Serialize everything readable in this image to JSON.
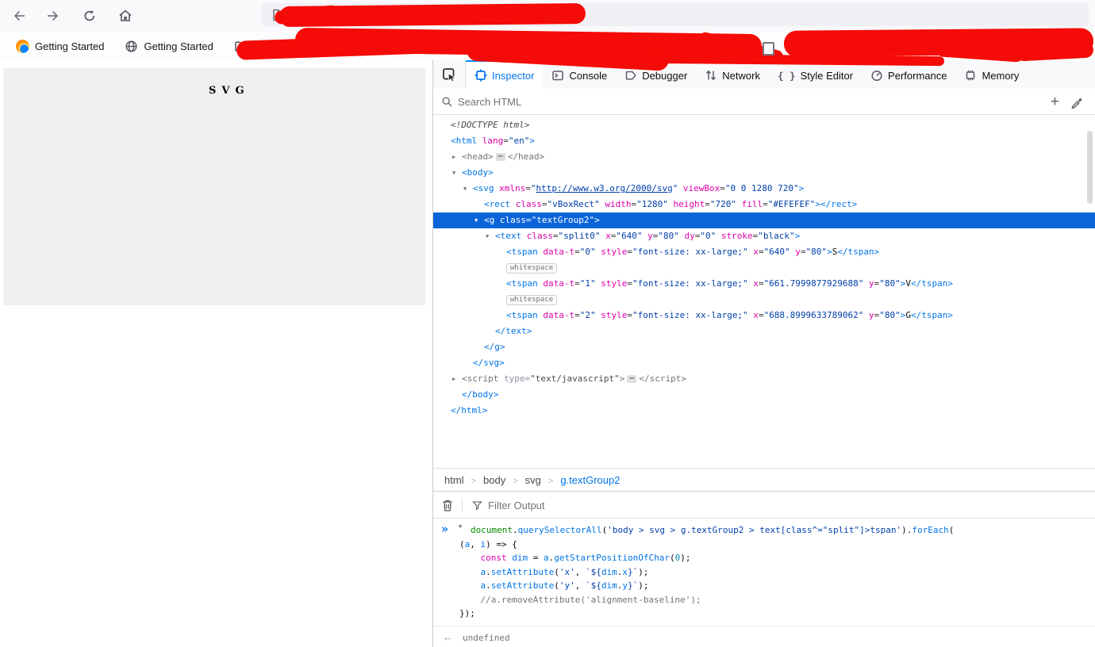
{
  "browser": {
    "nav": {
      "back_icon": "back-arrow",
      "forward_icon": "forward-arrow",
      "reload_icon": "reload",
      "home_icon": "home",
      "url_bar": {
        "value": "",
        "page_icon": "file"
      }
    },
    "bookmarks": [
      {
        "icon": "firefox-logo",
        "label": "Getting Started"
      },
      {
        "icon": "globe",
        "label": "Getting Started"
      },
      {
        "icon": "folder",
        "label": ""
      }
    ]
  },
  "page": {
    "svg_letters": [
      "S",
      "V",
      "G"
    ],
    "rect_fill": "#EFEFEF"
  },
  "devtools": {
    "tabs": [
      {
        "id": "inspector",
        "label": "Inspector",
        "active": true
      },
      {
        "id": "console",
        "label": "Console",
        "active": false
      },
      {
        "id": "debugger",
        "label": "Debugger",
        "active": false
      },
      {
        "id": "network",
        "label": "Network",
        "active": false
      },
      {
        "id": "style-editor",
        "label": "Style Editor",
        "active": false
      },
      {
        "id": "performance",
        "label": "Performance",
        "active": false
      },
      {
        "id": "memory",
        "label": "Memory",
        "active": false
      }
    ],
    "search": {
      "placeholder": "Search HTML"
    },
    "markup": {
      "rows": [
        {
          "i": 0,
          "tk": [
            [
              "d",
              "<!DOCTYPE html>"
            ]
          ]
        },
        {
          "i": 0,
          "tk": [
            [
              "t",
              "<html"
            ],
            [
              "a",
              " lang"
            ],
            [
              "p",
              "="
            ],
            [
              "v",
              "\"en\""
            ],
            [
              "t",
              ">"
            ]
          ]
        },
        {
          "i": 1,
          "ar": "r",
          "tk": [
            [
              "mt",
              "<head>"
            ],
            [
              "be",
              "⋯"
            ],
            [
              "mt",
              "</head>"
            ]
          ]
        },
        {
          "i": 1,
          "ar": "d",
          "tk": [
            [
              "t",
              "<body>"
            ]
          ]
        },
        {
          "i": 2,
          "ar": "d",
          "tk": [
            [
              "t",
              "<svg"
            ],
            [
              "a",
              " xmlns"
            ],
            [
              "p",
              "="
            ],
            [
              "v",
              "\""
            ],
            [
              "u",
              "http://www.w3.org/2000/svg"
            ],
            [
              "v",
              "\""
            ],
            [
              "a",
              " viewBox"
            ],
            [
              "p",
              "="
            ],
            [
              "v",
              "\"0 0 1280 720\""
            ],
            [
              "t",
              ">"
            ]
          ]
        },
        {
          "i": 3,
          "tk": [
            [
              "t",
              "<rect"
            ],
            [
              "a",
              " class"
            ],
            [
              "p",
              "="
            ],
            [
              "v",
              "\"vBoxRect\""
            ],
            [
              "a",
              " width"
            ],
            [
              "p",
              "="
            ],
            [
              "v",
              "\"1280\""
            ],
            [
              "a",
              " height"
            ],
            [
              "p",
              "="
            ],
            [
              "v",
              "\"720\""
            ],
            [
              "a",
              " fill"
            ],
            [
              "p",
              "="
            ],
            [
              "v",
              "\"#EFEFEF\""
            ],
            [
              "t",
              "></rect>"
            ]
          ]
        },
        {
          "i": 3,
          "ar": "d",
          "sel": true,
          "tk": [
            [
              "t",
              "<g"
            ],
            [
              "a",
              " class"
            ],
            [
              "p",
              "="
            ],
            [
              "v",
              "\"textGroup2\""
            ],
            [
              "t",
              ">"
            ]
          ]
        },
        {
          "i": 4,
          "ar": "d",
          "tk": [
            [
              "t",
              "<text"
            ],
            [
              "a",
              " class"
            ],
            [
              "p",
              "="
            ],
            [
              "v",
              "\"split0\""
            ],
            [
              "a",
              " x"
            ],
            [
              "p",
              "="
            ],
            [
              "v",
              "\"640\""
            ],
            [
              "a",
              " y"
            ],
            [
              "p",
              "="
            ],
            [
              "v",
              "\"80\""
            ],
            [
              "a",
              " dy"
            ],
            [
              "p",
              "="
            ],
            [
              "v",
              "\"0\""
            ],
            [
              "a",
              " stroke"
            ],
            [
              "p",
              "="
            ],
            [
              "v",
              "\"black\""
            ],
            [
              "t",
              ">"
            ]
          ]
        },
        {
          "i": 5,
          "tk": [
            [
              "t",
              "<tspan"
            ],
            [
              "a",
              " data-t"
            ],
            [
              "p",
              "="
            ],
            [
              "v",
              "\"0\""
            ],
            [
              "a",
              " style"
            ],
            [
              "p",
              "="
            ],
            [
              "v",
              "\"font-size: xx-large;\""
            ],
            [
              "a",
              " x"
            ],
            [
              "p",
              "="
            ],
            [
              "v",
              "\"640\""
            ],
            [
              "a",
              " y"
            ],
            [
              "p",
              "="
            ],
            [
              "v",
              "\"80\""
            ],
            [
              "t",
              ">"
            ],
            [
              "x",
              "S"
            ],
            [
              "t",
              "</tspan>"
            ]
          ]
        },
        {
          "i": 5,
          "tk": [
            [
              "bw",
              "whitespace"
            ]
          ]
        },
        {
          "i": 5,
          "tk": [
            [
              "t",
              "<tspan"
            ],
            [
              "a",
              " data-t"
            ],
            [
              "p",
              "="
            ],
            [
              "v",
              "\"1\""
            ],
            [
              "a",
              " style"
            ],
            [
              "p",
              "="
            ],
            [
              "v",
              "\"font-size: xx-large;\""
            ],
            [
              "a",
              " x"
            ],
            [
              "p",
              "="
            ],
            [
              "v",
              "\"661.7999877929688\""
            ],
            [
              "a",
              " y"
            ],
            [
              "p",
              "="
            ],
            [
              "v",
              "\"80\""
            ],
            [
              "t",
              ">"
            ],
            [
              "x",
              "V"
            ],
            [
              "t",
              "</tspan>"
            ]
          ]
        },
        {
          "i": 5,
          "tk": [
            [
              "bw",
              "whitespace"
            ]
          ]
        },
        {
          "i": 5,
          "tk": [
            [
              "t",
              "<tspan"
            ],
            [
              "a",
              " data-t"
            ],
            [
              "p",
              "="
            ],
            [
              "v",
              "\"2\""
            ],
            [
              "a",
              " style"
            ],
            [
              "p",
              "="
            ],
            [
              "v",
              "\"font-size: xx-large;\""
            ],
            [
              "a",
              " x"
            ],
            [
              "p",
              "="
            ],
            [
              "v",
              "\"688.8999633789062\""
            ],
            [
              "a",
              " y"
            ],
            [
              "p",
              "="
            ],
            [
              "v",
              "\"80\""
            ],
            [
              "t",
              ">"
            ],
            [
              "x",
              "G"
            ],
            [
              "t",
              "</tspan>"
            ]
          ]
        },
        {
          "i": 4,
          "tk": [
            [
              "t",
              "</text>"
            ]
          ]
        },
        {
          "i": 3,
          "tk": [
            [
              "t",
              "</g>"
            ]
          ]
        },
        {
          "i": 2,
          "tk": [
            [
              "t",
              "</svg>"
            ]
          ]
        },
        {
          "i": 1,
          "ar": "r",
          "tk": [
            [
              "mt",
              "<script"
            ],
            [
              "ma",
              " type"
            ],
            [
              "mp",
              "="
            ],
            [
              "mv",
              "\"text/javascript\""
            ],
            [
              "mt",
              ">"
            ],
            [
              "be",
              "⋯"
            ],
            [
              "mt",
              "</script>"
            ]
          ]
        },
        {
          "i": 1,
          "tk": [
            [
              "t",
              "</body>"
            ]
          ]
        },
        {
          "i": 0,
          "tk": [
            [
              "t",
              "</html>"
            ]
          ]
        }
      ]
    },
    "breadcrumbs": [
      {
        "label": "html",
        "selected": false
      },
      {
        "label": "body",
        "selected": false
      },
      {
        "label": "svg",
        "selected": false
      },
      {
        "label": "g.textGroup2",
        "selected": true
      }
    ],
    "console": {
      "filter_placeholder": "Filter Output",
      "input_lines": [
        [
          [
            "g",
            "document"
          ],
          [
            "n",
            "."
          ],
          [
            "b",
            "querySelectorAll"
          ],
          [
            "n",
            "("
          ],
          [
            "s",
            "'body > svg > g.textGroup2 > text[class^=\"split\"]>tspan'"
          ],
          [
            "n",
            ")."
          ],
          [
            "b",
            "forEach"
          ],
          [
            "n",
            "("
          ]
        ],
        [
          [
            "n",
            "("
          ],
          [
            "b",
            "a"
          ],
          [
            "n",
            ", "
          ],
          [
            "b",
            "i"
          ],
          [
            "n",
            ") => {"
          ]
        ],
        [
          [
            "n",
            "    "
          ],
          [
            "k",
            "const"
          ],
          [
            "n",
            " "
          ],
          [
            "b",
            "dim"
          ],
          [
            "n",
            " = "
          ],
          [
            "b",
            "a"
          ],
          [
            "n",
            "."
          ],
          [
            "b",
            "getStartPositionOfChar"
          ],
          [
            "n",
            "("
          ],
          [
            "m",
            "0"
          ],
          [
            "n",
            ");"
          ]
        ],
        [
          [
            "n",
            "    "
          ],
          [
            "b",
            "a"
          ],
          [
            "n",
            "."
          ],
          [
            "b",
            "setAttribute"
          ],
          [
            "n",
            "("
          ],
          [
            "s",
            "'x'"
          ],
          [
            "n",
            ", "
          ],
          [
            "s",
            "`${"
          ],
          [
            "b",
            "dim"
          ],
          [
            "n",
            "."
          ],
          [
            "b",
            "x"
          ],
          [
            "s",
            "}`"
          ],
          [
            "n",
            ");"
          ]
        ],
        [
          [
            "n",
            "    "
          ],
          [
            "b",
            "a"
          ],
          [
            "n",
            "."
          ],
          [
            "b",
            "setAttribute"
          ],
          [
            "n",
            "("
          ],
          [
            "s",
            "'y'"
          ],
          [
            "n",
            ", "
          ],
          [
            "s",
            "`${"
          ],
          [
            "b",
            "dim"
          ],
          [
            "n",
            "."
          ],
          [
            "b",
            "y"
          ],
          [
            "s",
            "}`"
          ],
          [
            "n",
            ");"
          ]
        ],
        [
          [
            "n",
            "    "
          ],
          [
            "c",
            "//a.removeAttribute('alignment-baseline');"
          ]
        ],
        [
          [
            "n",
            "});"
          ]
        ]
      ],
      "result": "undefined"
    }
  },
  "colors": {
    "accent_blue": "#0074e8",
    "selection_blue": "#0c65d8",
    "scribble_red": "#f50b07",
    "svg_rect_fill": "#EFEFEF"
  }
}
